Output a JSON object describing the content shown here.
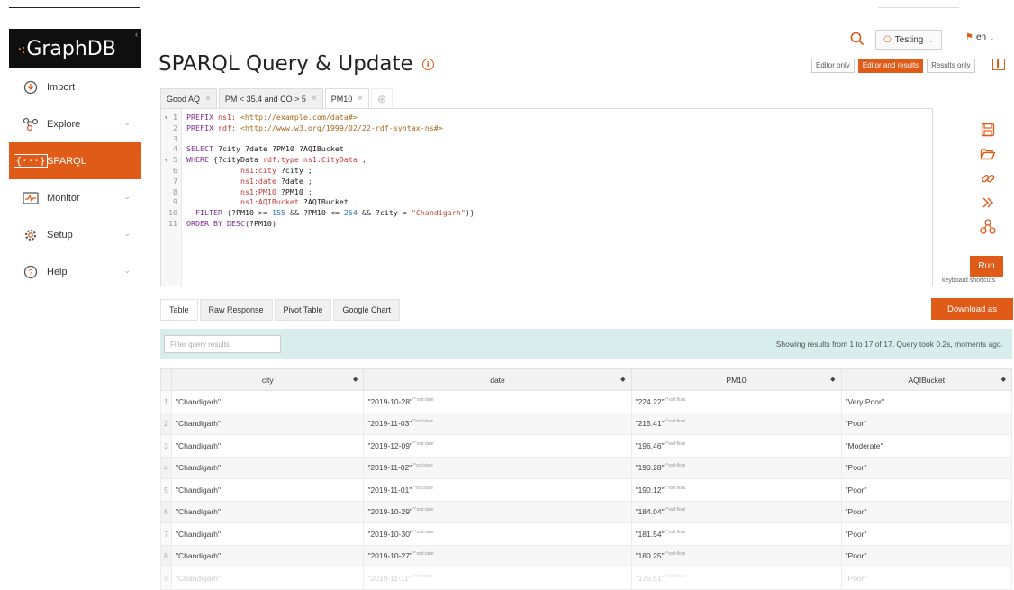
{
  "sidebar": {
    "logo": "GraphDB",
    "items": [
      {
        "label": "Import",
        "icon": "import-icon",
        "chevron": false
      },
      {
        "label": "Explore",
        "icon": "explore-icon",
        "chevron": true
      },
      {
        "label": "SPARQL",
        "icon": "sparql-icon",
        "chevron": false,
        "active": true
      },
      {
        "label": "Monitor",
        "icon": "monitor-icon",
        "chevron": true
      },
      {
        "label": "Setup",
        "icon": "gear-icon",
        "chevron": true
      },
      {
        "label": "Help",
        "icon": "help-icon",
        "chevron": true
      }
    ]
  },
  "header": {
    "title": "SPARQL Query & Update",
    "repo": "Testing",
    "lang": "en",
    "view_modes": [
      "Editor only",
      "Editor and results",
      "Results only"
    ],
    "active_view_mode": "Editor and results"
  },
  "query_tabs": [
    {
      "label": "Good AQ",
      "active": false
    },
    {
      "label": "PM < 35.4 and CO > 5",
      "active": false
    },
    {
      "label": "PM10",
      "active": true
    }
  ],
  "editor": {
    "lines": [
      {
        "n": "1",
        "marker": "▾",
        "text": "PREFIX ns1: <http://example.com/data#>"
      },
      {
        "n": "2",
        "marker": "",
        "text": "PREFIX rdf: <http://www.w3.org/1999/02/22-rdf-syntax-ns#>"
      },
      {
        "n": "3",
        "marker": "",
        "text": ""
      },
      {
        "n": "4",
        "marker": "",
        "text": "SELECT ?city ?date ?PM10 ?AQIBucket"
      },
      {
        "n": "5",
        "marker": "▾",
        "text": "WHERE {?cityData rdf:type ns1:CityData ;"
      },
      {
        "n": "6",
        "marker": "",
        "text": "            ns1:city ?city ;"
      },
      {
        "n": "7",
        "marker": "",
        "text": "            ns1:date ?date ;"
      },
      {
        "n": "8",
        "marker": "",
        "text": "            ns1:PM10 ?PM10 ;"
      },
      {
        "n": "9",
        "marker": "",
        "text": "            ns1:AQIBucket ?AQIBucket ."
      },
      {
        "n": "10",
        "marker": "",
        "text": "  FILTER (?PM10 >= 155 && ?PM10 <= 254 && ?city = \"Chandigarh\")}"
      },
      {
        "n": "11",
        "marker": "",
        "text": "ORDER BY DESC(?PM10)"
      }
    ],
    "run_label": "Run",
    "shortcuts_label": "keyboard shortcuts"
  },
  "result_tabs": [
    {
      "label": "Table",
      "active": true
    },
    {
      "label": "Raw Response",
      "active": false
    },
    {
      "label": "Pivot Table",
      "active": false
    },
    {
      "label": "Google Chart",
      "active": false
    }
  ],
  "download_label": "Download as",
  "filter": {
    "placeholder": "Filter query results",
    "value": ""
  },
  "results_info": "Showing results from 1 to 17 of 17. Query took 0.2s, moments ago.",
  "table": {
    "columns": [
      "city",
      "date",
      "PM10",
      "AQIBucket"
    ],
    "rows": [
      {
        "idx": "1",
        "city": "\"Chandigarh\"",
        "date": "\"2019-10-28\"",
        "date_type": "^^xsd:date",
        "pm10": "\"224.22\"",
        "pm10_type": "^^xsd:float",
        "aqi": "\"Very Poor\""
      },
      {
        "idx": "2",
        "city": "\"Chandigarh\"",
        "date": "\"2019-11-03\"",
        "date_type": "^^xsd:date",
        "pm10": "\"215.41\"",
        "pm10_type": "^^xsd:float",
        "aqi": "\"Poor\""
      },
      {
        "idx": "3",
        "city": "\"Chandigarh\"",
        "date": "\"2019-12-09\"",
        "date_type": "^^xsd:date",
        "pm10": "\"196.46\"",
        "pm10_type": "^^xsd:float",
        "aqi": "\"Moderate\""
      },
      {
        "idx": "4",
        "city": "\"Chandigarh\"",
        "date": "\"2019-11-02\"",
        "date_type": "^^xsd:date",
        "pm10": "\"190.28\"",
        "pm10_type": "^^xsd:float",
        "aqi": "\"Poor\""
      },
      {
        "idx": "5",
        "city": "\"Chandigarh\"",
        "date": "\"2019-11-01\"",
        "date_type": "^^xsd:date",
        "pm10": "\"190.12\"",
        "pm10_type": "^^xsd:float",
        "aqi": "\"Poor\""
      },
      {
        "idx": "6",
        "city": "\"Chandigarh\"",
        "date": "\"2019-10-29\"",
        "date_type": "^^xsd:date",
        "pm10": "\"184.04\"",
        "pm10_type": "^^xsd:float",
        "aqi": "\"Poor\""
      },
      {
        "idx": "7",
        "city": "\"Chandigarh\"",
        "date": "\"2019-10-30\"",
        "date_type": "^^xsd:date",
        "pm10": "\"181.54\"",
        "pm10_type": "^^xsd:float",
        "aqi": "\"Poor\""
      },
      {
        "idx": "8",
        "city": "\"Chandigarh\"",
        "date": "\"2019-10-27\"",
        "date_type": "^^xsd:date",
        "pm10": "\"180.25\"",
        "pm10_type": "^^xsd:float",
        "aqi": "\"Poor\""
      },
      {
        "idx": "9",
        "city": "\"Chandigarh\"",
        "date": "\"2019-11-11\"",
        "date_type": "^^xsd:date",
        "pm10": "\"175.51\"",
        "pm10_type": "^^xsd:float",
        "aqi": "\"Poor\""
      }
    ]
  },
  "colors": {
    "accent": "#e05a18",
    "results_bar": "#d8eeec",
    "sidebar_logo_bg": "#0f0f0f"
  }
}
